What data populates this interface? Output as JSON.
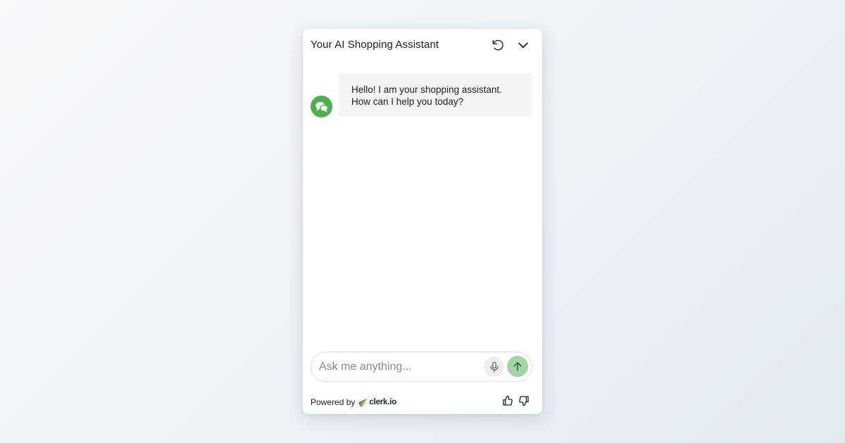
{
  "widget": {
    "title": "Your AI Shopping Assistant"
  },
  "header": {
    "reset_icon": "reset-icon",
    "collapse_icon": "chevron-down-icon"
  },
  "messages": [
    {
      "sender": "bot",
      "avatar_icon": "chat-bubbles-icon",
      "lines": [
        "Hello! I am your shopping assistant.",
        "How can I help you today?"
      ]
    }
  ],
  "input": {
    "placeholder": "Ask me anything...",
    "value": "",
    "mic_icon": "microphone-icon",
    "send_icon": "arrow-up-icon"
  },
  "footer": {
    "powered_by": "Powered by",
    "brand": "clerk.io",
    "thumbs_up_icon": "thumbs-up-icon",
    "thumbs_down_icon": "thumbs-down-icon"
  },
  "colors": {
    "accent": "#4caf50",
    "send_button": "#a4d5a6",
    "bubble_bg": "#f4f4f4",
    "text": "#1d1d1f"
  }
}
